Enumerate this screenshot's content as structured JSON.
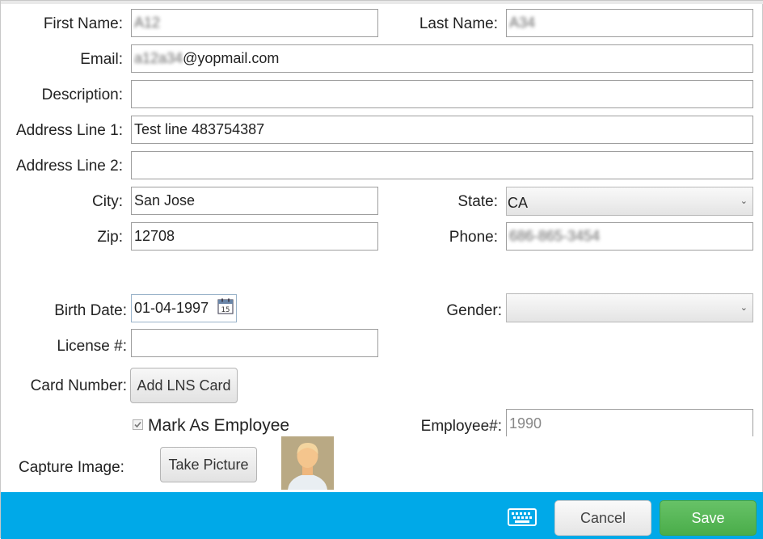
{
  "form": {
    "first_name": {
      "label": "First Name:",
      "value": "A12"
    },
    "last_name": {
      "label": "Last Name:",
      "value": "A34"
    },
    "email": {
      "label": "Email:",
      "value_prefix": "a12a34",
      "value_suffix": "@yopmail.com"
    },
    "description": {
      "label": "Description:",
      "value": ""
    },
    "address1": {
      "label": "Address Line 1:",
      "value": "Test line 483754387"
    },
    "address2": {
      "label": "Address Line 2:",
      "value": ""
    },
    "city": {
      "label": "City:",
      "value": "San Jose"
    },
    "state": {
      "label": "State:",
      "value": "CA"
    },
    "zip": {
      "label": "Zip:",
      "value": "12708"
    },
    "phone": {
      "label": "Phone:",
      "value": "686-865-3454"
    },
    "birth_date": {
      "label": "Birth Date:",
      "value": "01-04-1997",
      "calendar_day": "15"
    },
    "gender": {
      "label": "Gender:",
      "value": ""
    },
    "license": {
      "label": "License #:",
      "value": ""
    },
    "card_number": {
      "label": "Card Number:",
      "button": "Add LNS Card"
    },
    "mark_employee": {
      "label": "Mark As Employee",
      "checked": true
    },
    "employee_num": {
      "label": "Employee#:",
      "value": "1990"
    },
    "capture_image": {
      "label": "Capture Image:",
      "button": "Take Picture"
    }
  },
  "footer": {
    "cancel_label": "Cancel",
    "save_label": "Save",
    "bar_color": "#00a9e8",
    "save_color": "#4caf50"
  }
}
